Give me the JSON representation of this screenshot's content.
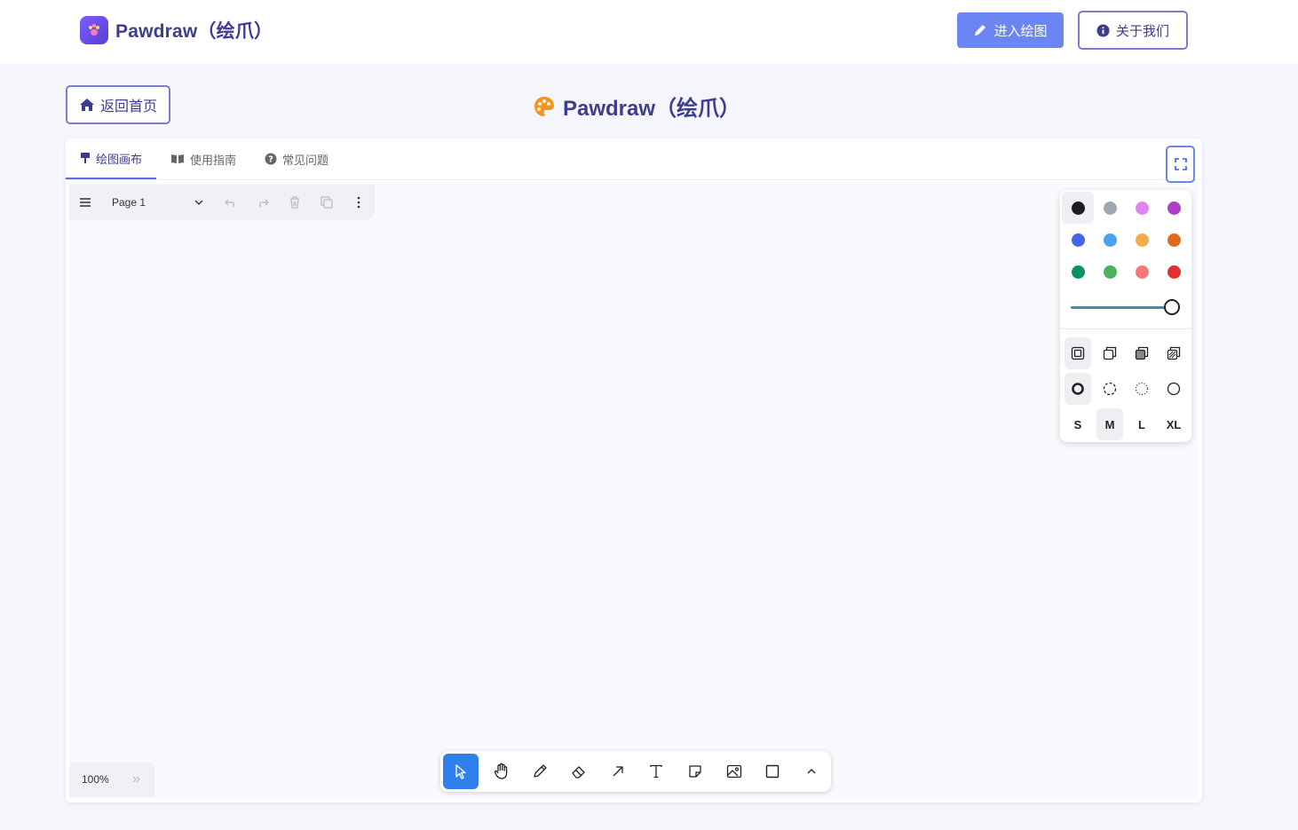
{
  "navbar": {
    "brand_name": "Pawdraw（绘爪）",
    "enter_button": "进入绘图",
    "about_button": "关于我们"
  },
  "header": {
    "back_button": "返回首页",
    "title": "Pawdraw（绘爪）"
  },
  "tabs": [
    {
      "label": "绘图画布",
      "icon": "paintbrush-icon",
      "active": true
    },
    {
      "label": "使用指南",
      "icon": "book-icon",
      "active": false
    },
    {
      "label": "常见问题",
      "icon": "question-circle-icon",
      "active": false
    }
  ],
  "page_menu": {
    "page_name": "Page 1"
  },
  "style_panel": {
    "colors": [
      {
        "name": "black",
        "hex": "#1d1d1d",
        "selected": true
      },
      {
        "name": "grey",
        "hex": "#9fa8b2"
      },
      {
        "name": "light-violet",
        "hex": "#e085f4"
      },
      {
        "name": "violet",
        "hex": "#ae3ec9"
      },
      {
        "name": "blue",
        "hex": "#4465e9"
      },
      {
        "name": "light-blue",
        "hex": "#4ba1f1"
      },
      {
        "name": "yellow",
        "hex": "#f1ac4b"
      },
      {
        "name": "orange",
        "hex": "#e16919"
      },
      {
        "name": "green",
        "hex": "#099268"
      },
      {
        "name": "light-green",
        "hex": "#4cb05e"
      },
      {
        "name": "light-red",
        "hex": "#f87777"
      },
      {
        "name": "red",
        "hex": "#e03131"
      }
    ],
    "opacity_value": 1,
    "sizes": [
      "S",
      "M",
      "L",
      "XL"
    ],
    "selected_size": "M"
  },
  "zoom": {
    "level": "100%"
  },
  "colors": {
    "accent": "#2f80ed",
    "brand": "#3d3d8f",
    "enter_button_bg": "#6b85f2"
  }
}
